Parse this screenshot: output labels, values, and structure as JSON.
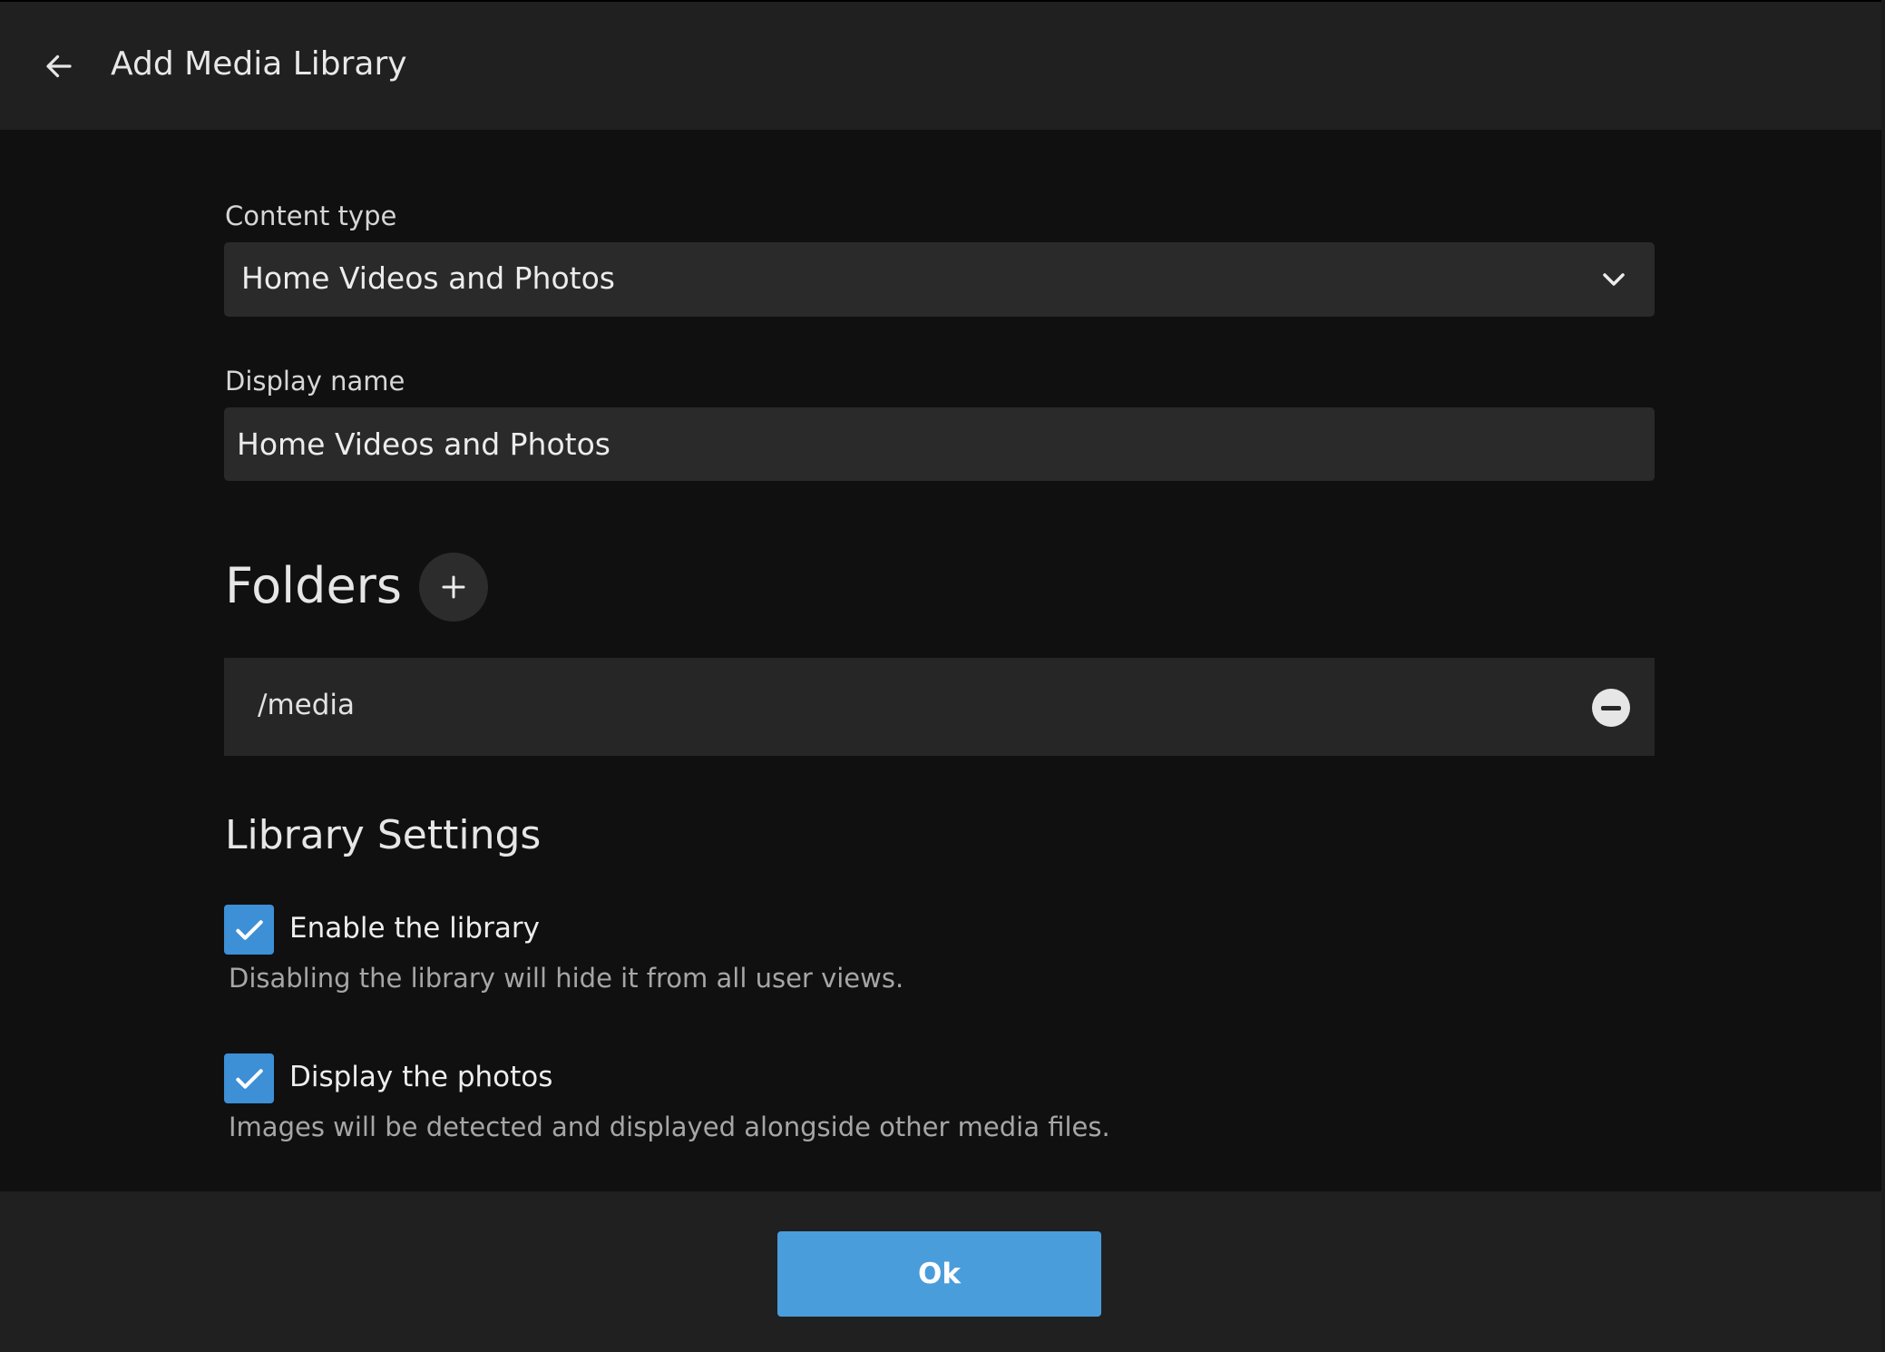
{
  "header": {
    "back_icon": "arrow-left-icon",
    "title": "Add Media Library"
  },
  "content_type": {
    "label": "Content type",
    "selected": "Home Videos and Photos",
    "icon": "chevron-down-icon"
  },
  "display_name": {
    "label": "Display name",
    "value": "Home Videos and Photos"
  },
  "folders": {
    "title": "Folders",
    "add_icon": "plus-icon",
    "items": [
      {
        "path": "/media",
        "remove_icon": "minus-circle-icon"
      }
    ]
  },
  "library_settings": {
    "title": "Library Settings",
    "options": [
      {
        "label": "Enable the library",
        "description": "Disabling the library will hide it from all user views.",
        "checked": true
      },
      {
        "label": "Display the photos",
        "description": "Images will be detected and displayed alongside other media files.",
        "checked": true
      }
    ]
  },
  "footer": {
    "ok_label": "Ok"
  },
  "colors": {
    "accent": "#4a9ddb",
    "checkbox": "#3d8fd6",
    "background": "#101010",
    "header": "#202020",
    "field": "#2a2a2a"
  }
}
